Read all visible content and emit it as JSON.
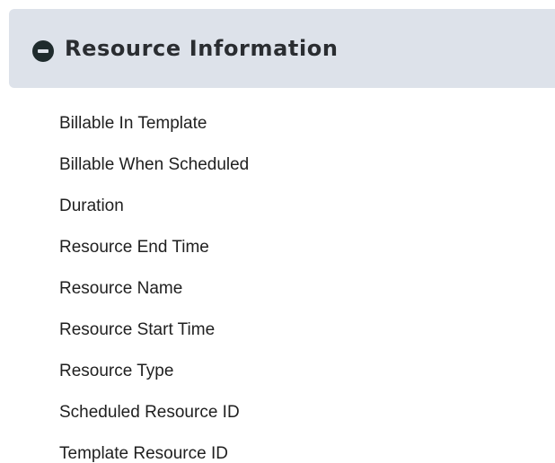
{
  "section": {
    "title": "Resource Information",
    "icon": "minus-circle-icon",
    "fields": [
      "Billable In Template",
      "Billable When Scheduled",
      "Duration",
      "Resource End Time",
      "Resource Name",
      "Resource Start Time",
      "Resource Type",
      "Scheduled Resource ID",
      "Template Resource ID"
    ]
  }
}
